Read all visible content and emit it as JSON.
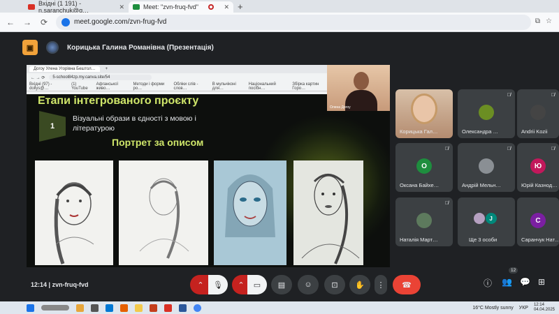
{
  "browser": {
    "tabs": [
      {
        "label": "Вхідні (1 191) - n.saranchuk@g…",
        "icon_color": "#d93025"
      },
      {
        "label": "Meet: \"zvn-fruq-fvd\"",
        "icon_color": "#1e8e3e"
      }
    ],
    "new_tab": "+",
    "url": "meet.google.com/zvn-frug-fvd",
    "nav": {
      "back": "←",
      "forward": "→",
      "reload": "⟳"
    }
  },
  "meet": {
    "presenter_title": "Корицька Галина Романівна (Презентація)",
    "meeting_time": "12:14",
    "meeting_code": "zvn-fruq-fvd",
    "participant_count": "12"
  },
  "slide": {
    "inner_tab": "Догоу Улена Угорівна Бештол…",
    "inner_url": "5-school84zp.my.canva.site/54",
    "bookmarks": [
      "Вхідні (97) - dollys@…",
      "(1) YouTube",
      "Афганської живо…",
      "Методи і форми ро…",
      "Обліки слів - слов…",
      "В мульчіконі для…",
      "Національний посібн…",
      "Збірка картин Горо…"
    ],
    "presenter_cam_caption": "Олена Догоу",
    "title": "Етапи інтегрованого проєкту",
    "step_number": "1",
    "step_text": "Візуальні образи в єдності з мовою і літературою",
    "subtitle": "Портрет за описом"
  },
  "participants": [
    {
      "name": "Корицька Гал…",
      "avatar": "",
      "color": "#c9a27c",
      "video": true
    },
    {
      "name": "Олександра …",
      "avatar": "",
      "color": "#6b8e23",
      "video": false
    },
    {
      "name": "Andrii Kozii",
      "avatar": "",
      "color": "#444",
      "video": false
    },
    {
      "name": "Оксана Байхе…",
      "avatar": "О",
      "color": "#1e8e3e",
      "video": false
    },
    {
      "name": "Андрій Мельн…",
      "avatar": "",
      "color": "#8a8f94",
      "video": false
    },
    {
      "name": "Юрій Казнод…",
      "avatar": "Ю",
      "color": "#c2185b",
      "video": false
    },
    {
      "name": "Наталія Март…",
      "avatar": "",
      "color": "#5d7a5d",
      "video": false
    },
    {
      "name": "Ще 3 особи",
      "avatar": "J",
      "color": "#00897b",
      "video": false
    },
    {
      "name": "Саранчук Нат…",
      "avatar": "С",
      "color": "#7b1fa2",
      "video": false
    }
  ],
  "taskbar": {
    "weather": "16°C Mostly sunny",
    "lang": "УКР",
    "time": "12:14",
    "date": "04.04.2025"
  }
}
